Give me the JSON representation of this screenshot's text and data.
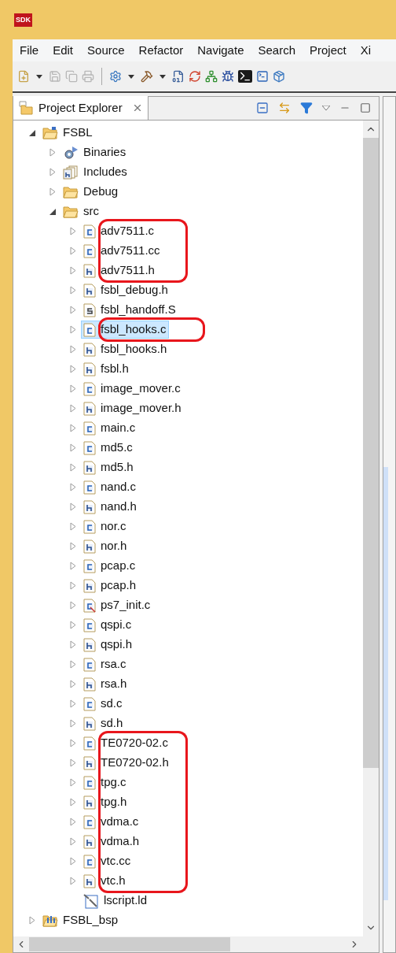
{
  "window": {
    "app_badge": "SDK"
  },
  "menu": [
    "File",
    "Edit",
    "Source",
    "Refactor",
    "Navigate",
    "Search",
    "Project",
    "Xi"
  ],
  "panel": {
    "tab": {
      "title": "Project Explorer",
      "selected": true
    }
  },
  "tree": [
    {
      "label": "FSBL",
      "kind": "project",
      "expanded": true,
      "selected": false,
      "circled": false,
      "children": [
        {
          "label": "Binaries",
          "kind": "binaries",
          "expanded": false,
          "selected": false,
          "circled": false
        },
        {
          "label": "Includes",
          "kind": "includes",
          "expanded": false,
          "selected": false,
          "circled": false
        },
        {
          "label": "Debug",
          "kind": "folder",
          "expanded": false,
          "selected": false,
          "circled": false
        },
        {
          "label": "src",
          "kind": "folder",
          "expanded": true,
          "selected": false,
          "circled": false,
          "children": [
            {
              "label": "adv7511.c",
              "kind": "c",
              "expanded": false,
              "selected": false,
              "circled": true
            },
            {
              "label": "adv7511.cc",
              "kind": "c",
              "expanded": false,
              "selected": false,
              "circled": true
            },
            {
              "label": "adv7511.h",
              "kind": "h",
              "expanded": false,
              "selected": false,
              "circled": true
            },
            {
              "label": "fsbl_debug.h",
              "kind": "h",
              "expanded": false,
              "selected": false,
              "circled": false
            },
            {
              "label": "fsbl_handoff.S",
              "kind": "s",
              "expanded": false,
              "selected": false,
              "circled": false
            },
            {
              "label": "fsbl_hooks.c",
              "kind": "c",
              "expanded": false,
              "selected": true,
              "circled": true
            },
            {
              "label": "fsbl_hooks.h",
              "kind": "h",
              "expanded": false,
              "selected": false,
              "circled": false
            },
            {
              "label": "fsbl.h",
              "kind": "h",
              "expanded": false,
              "selected": false,
              "circled": false
            },
            {
              "label": "image_mover.c",
              "kind": "c",
              "expanded": false,
              "selected": false,
              "circled": false
            },
            {
              "label": "image_mover.h",
              "kind": "h",
              "expanded": false,
              "selected": false,
              "circled": false
            },
            {
              "label": "main.c",
              "kind": "c",
              "expanded": false,
              "selected": false,
              "circled": false
            },
            {
              "label": "md5.c",
              "kind": "c",
              "expanded": false,
              "selected": false,
              "circled": false
            },
            {
              "label": "md5.h",
              "kind": "h",
              "expanded": false,
              "selected": false,
              "circled": false
            },
            {
              "label": "nand.c",
              "kind": "c",
              "expanded": false,
              "selected": false,
              "circled": false
            },
            {
              "label": "nand.h",
              "kind": "h",
              "expanded": false,
              "selected": false,
              "circled": false
            },
            {
              "label": "nor.c",
              "kind": "c",
              "expanded": false,
              "selected": false,
              "circled": false
            },
            {
              "label": "nor.h",
              "kind": "h",
              "expanded": false,
              "selected": false,
              "circled": false
            },
            {
              "label": "pcap.c",
              "kind": "c",
              "expanded": false,
              "selected": false,
              "circled": false
            },
            {
              "label": "pcap.h",
              "kind": "h",
              "expanded": false,
              "selected": false,
              "circled": false
            },
            {
              "label": "ps7_init.c",
              "kind": "cgen",
              "expanded": false,
              "selected": false,
              "circled": false
            },
            {
              "label": "qspi.c",
              "kind": "c",
              "expanded": false,
              "selected": false,
              "circled": false
            },
            {
              "label": "qspi.h",
              "kind": "h",
              "expanded": false,
              "selected": false,
              "circled": false
            },
            {
              "label": "rsa.c",
              "kind": "c",
              "expanded": false,
              "selected": false,
              "circled": false
            },
            {
              "label": "rsa.h",
              "kind": "h",
              "expanded": false,
              "selected": false,
              "circled": false
            },
            {
              "label": "sd.c",
              "kind": "c",
              "expanded": false,
              "selected": false,
              "circled": false
            },
            {
              "label": "sd.h",
              "kind": "h",
              "expanded": false,
              "selected": false,
              "circled": false
            },
            {
              "label": "TE0720-02.c",
              "kind": "c",
              "expanded": false,
              "selected": false,
              "circled": true
            },
            {
              "label": "TE0720-02.h",
              "kind": "h",
              "expanded": false,
              "selected": false,
              "circled": true
            },
            {
              "label": "tpg.c",
              "kind": "c",
              "expanded": false,
              "selected": false,
              "circled": true
            },
            {
              "label": "tpg.h",
              "kind": "h",
              "expanded": false,
              "selected": false,
              "circled": true
            },
            {
              "label": "vdma.c",
              "kind": "c",
              "expanded": false,
              "selected": false,
              "circled": true
            },
            {
              "label": "vdma.h",
              "kind": "h",
              "expanded": false,
              "selected": false,
              "circled": true
            },
            {
              "label": "vtc.cc",
              "kind": "c",
              "expanded": false,
              "selected": false,
              "circled": true
            },
            {
              "label": "vtc.h",
              "kind": "h",
              "expanded": false,
              "selected": false,
              "circled": true
            },
            {
              "label": "lscript.ld",
              "kind": "ld",
              "selected": false,
              "circled": false
            }
          ]
        }
      ]
    },
    {
      "label": "FSBL_bsp",
      "kind": "bsp",
      "expanded": false,
      "selected": false,
      "circled": false
    }
  ]
}
